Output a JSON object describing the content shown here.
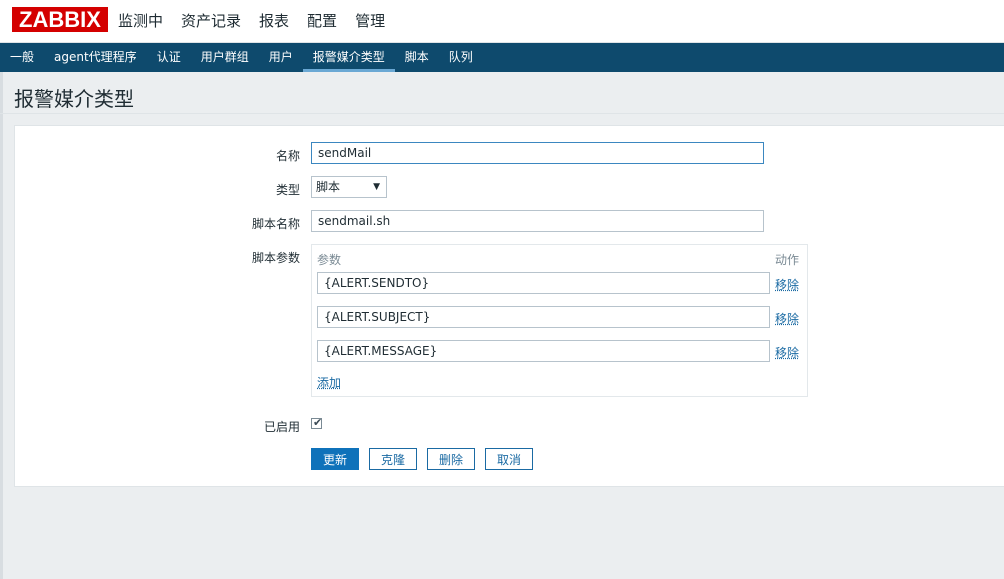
{
  "logo": {
    "text": "ZABBIX"
  },
  "main_nav": [
    {
      "label": "监测中"
    },
    {
      "label": "资产记录"
    },
    {
      "label": "报表"
    },
    {
      "label": "配置"
    },
    {
      "label": "管理"
    }
  ],
  "sub_nav": [
    {
      "label": "一般",
      "active": false
    },
    {
      "label": "agent代理程序",
      "active": false
    },
    {
      "label": "认证",
      "active": false
    },
    {
      "label": "用户群组",
      "active": false
    },
    {
      "label": "用户",
      "active": false
    },
    {
      "label": "报警媒介类型",
      "active": true
    },
    {
      "label": "脚本",
      "active": false
    },
    {
      "label": "队列",
      "active": false
    }
  ],
  "page": {
    "title": "报警媒介类型"
  },
  "form": {
    "name_label": "名称",
    "name_value": "sendMail",
    "type_label": "类型",
    "type_value": "脚本",
    "script_name_label": "脚本名称",
    "script_name_value": "sendmail.sh",
    "script_params_label": "脚本参数",
    "params_header": "参数",
    "action_header": "动作",
    "params": [
      {
        "value": "{ALERT.SENDTO}",
        "remove_label": "移除"
      },
      {
        "value": "{ALERT.SUBJECT}",
        "remove_label": "移除"
      },
      {
        "value": "{ALERT.MESSAGE}",
        "remove_label": "移除"
      }
    ],
    "add_label": "添加",
    "enabled_label": "已启用",
    "enabled": true
  },
  "buttons": {
    "update": "更新",
    "clone": "克隆",
    "delete": "删除",
    "cancel": "取消"
  },
  "colors": {
    "logo_bg": "#d40000",
    "subnav_bg": "#0e4a6d",
    "primary_button": "#0f72ba",
    "link": "#1a6aa3"
  }
}
